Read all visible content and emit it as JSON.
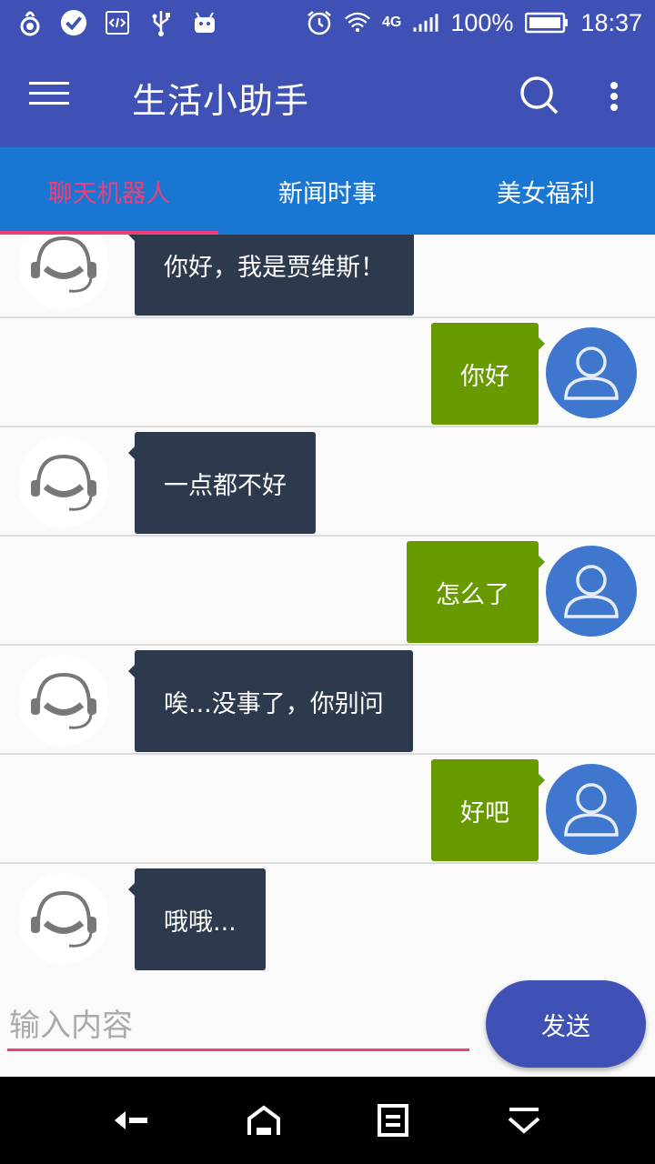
{
  "status_bar": {
    "battery": "100%",
    "time": "18:37",
    "network": "4G",
    "icons": [
      "notification-icon",
      "check-icon",
      "code-icon",
      "usb-icon",
      "android-icon",
      "alarm-icon",
      "wifi-icon",
      "signal-icon",
      "battery-icon"
    ]
  },
  "app_bar": {
    "title": "生活小助手",
    "icons": [
      "menu-icon",
      "search-icon",
      "more-vert-icon"
    ]
  },
  "tabs": [
    {
      "label": "聊天机器人",
      "active": true
    },
    {
      "label": "新闻时事",
      "active": false
    },
    {
      "label": "美女福利",
      "active": false
    }
  ],
  "messages": [
    {
      "from": "bot",
      "text": "你好，我是贾维斯！"
    },
    {
      "from": "user",
      "text": "你好"
    },
    {
      "from": "bot",
      "text": "一点都不好"
    },
    {
      "from": "user",
      "text": "怎么了"
    },
    {
      "from": "bot",
      "text": "唉...没事了，你别问"
    },
    {
      "from": "user",
      "text": "好吧"
    },
    {
      "from": "bot",
      "text": "哦哦..."
    }
  ],
  "input": {
    "placeholder": "输入内容",
    "value": ""
  },
  "send_label": "发送",
  "colors": {
    "primary": "#3f51b5",
    "tab_bar": "#1976d2",
    "accent": "#ec407a",
    "bot_bubble": "#2d3a4e",
    "user_bubble": "#689a00",
    "user_avatar": "#3f77cf"
  },
  "nav_bar": {
    "icons": [
      "back-icon",
      "home-icon",
      "recents-icon",
      "hide-keyboard-icon"
    ]
  }
}
